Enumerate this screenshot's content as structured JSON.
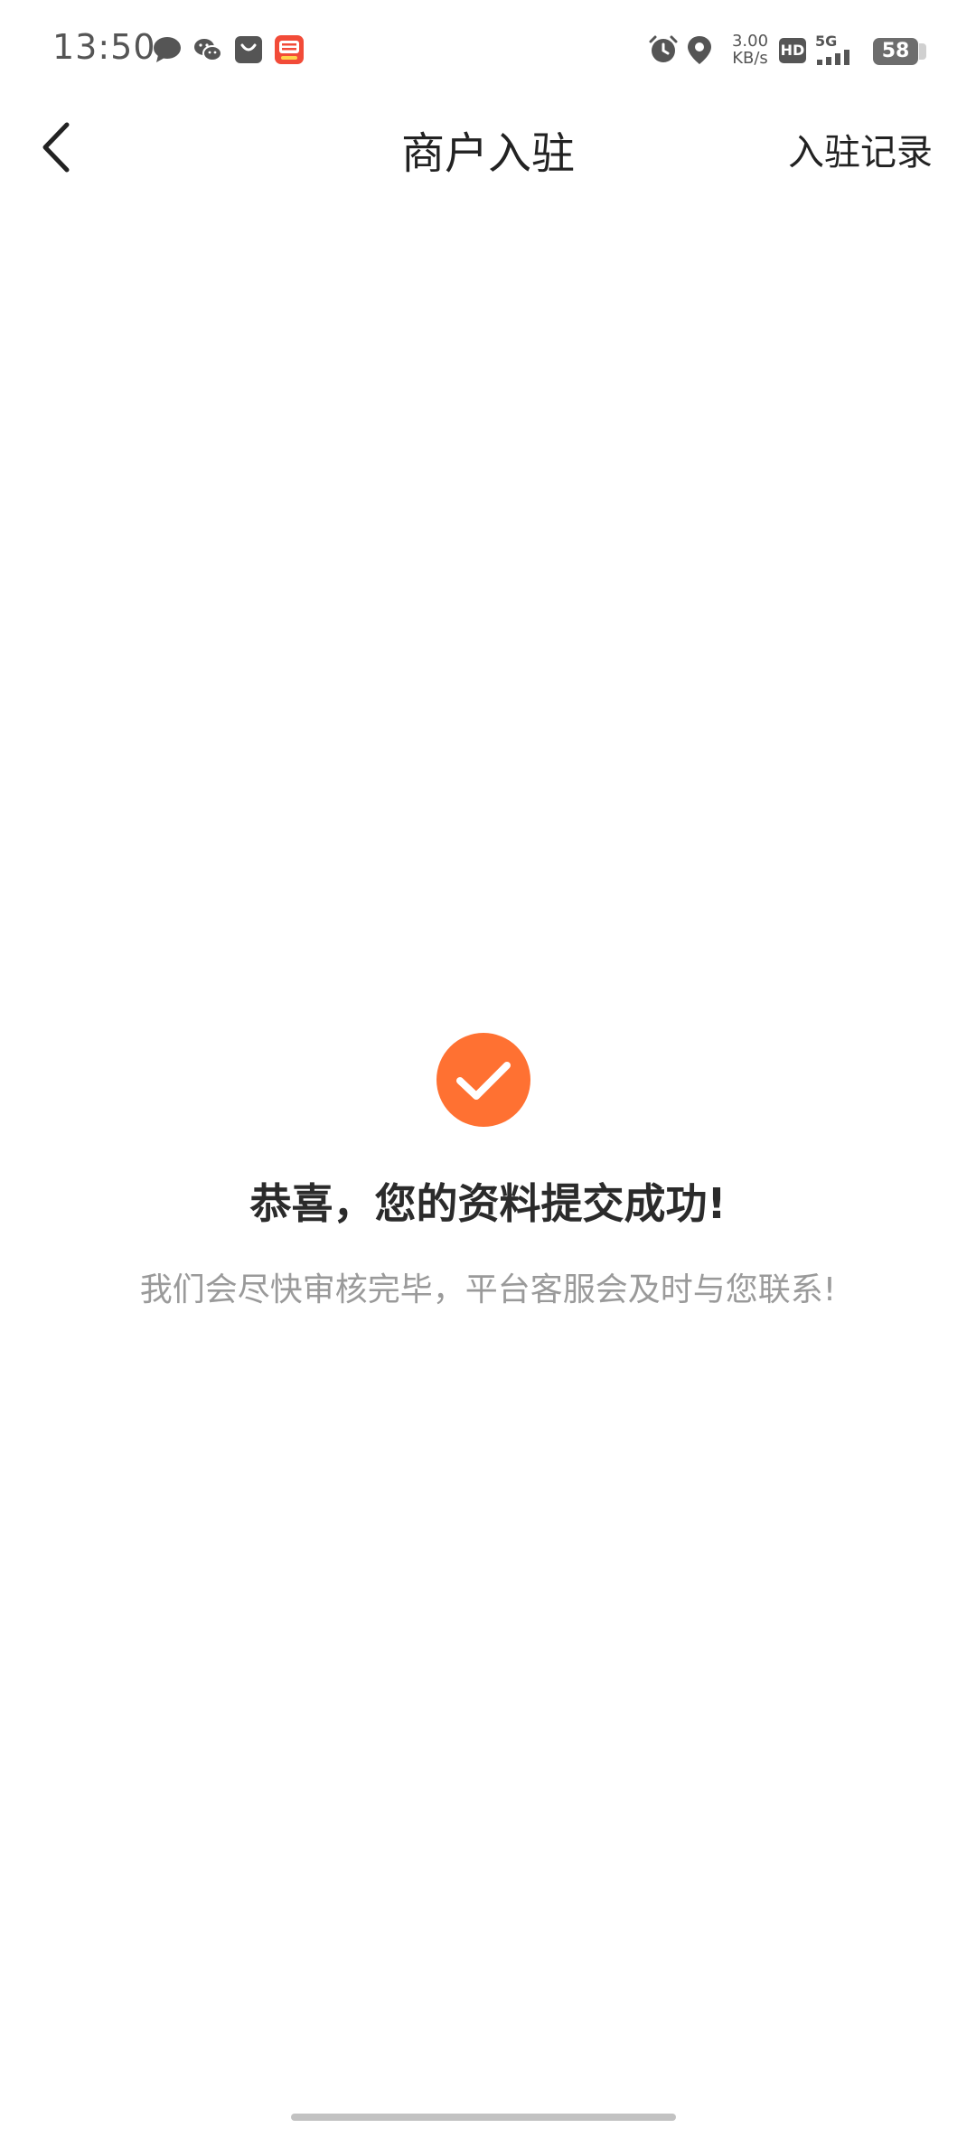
{
  "status_bar": {
    "time": "13:50",
    "net_speed_value": "3.00",
    "net_speed_unit": "KB/s",
    "hd_label": "HD",
    "network_label": "5G",
    "battery_level": "58",
    "icons": [
      "message-icon",
      "wechat-icon",
      "shopping-bag-icon",
      "taobao-app-icon",
      "alarm-icon",
      "location-icon",
      "hd-icon",
      "signal-icon",
      "battery-icon"
    ]
  },
  "nav": {
    "back_icon": "chevron-left-icon",
    "title": "商户入驻",
    "action_label": "入驻记录"
  },
  "result": {
    "icon": "check-circle-icon",
    "title": "恭喜，您的资料提交成功!",
    "description": "我们会尽快审核完毕，平台客服会及时与您联系!"
  },
  "colors": {
    "accent": "#FF7132",
    "title_text": "#2B2B2B",
    "secondary_text": "#9A9A9A",
    "background": "#FFFFFF"
  }
}
